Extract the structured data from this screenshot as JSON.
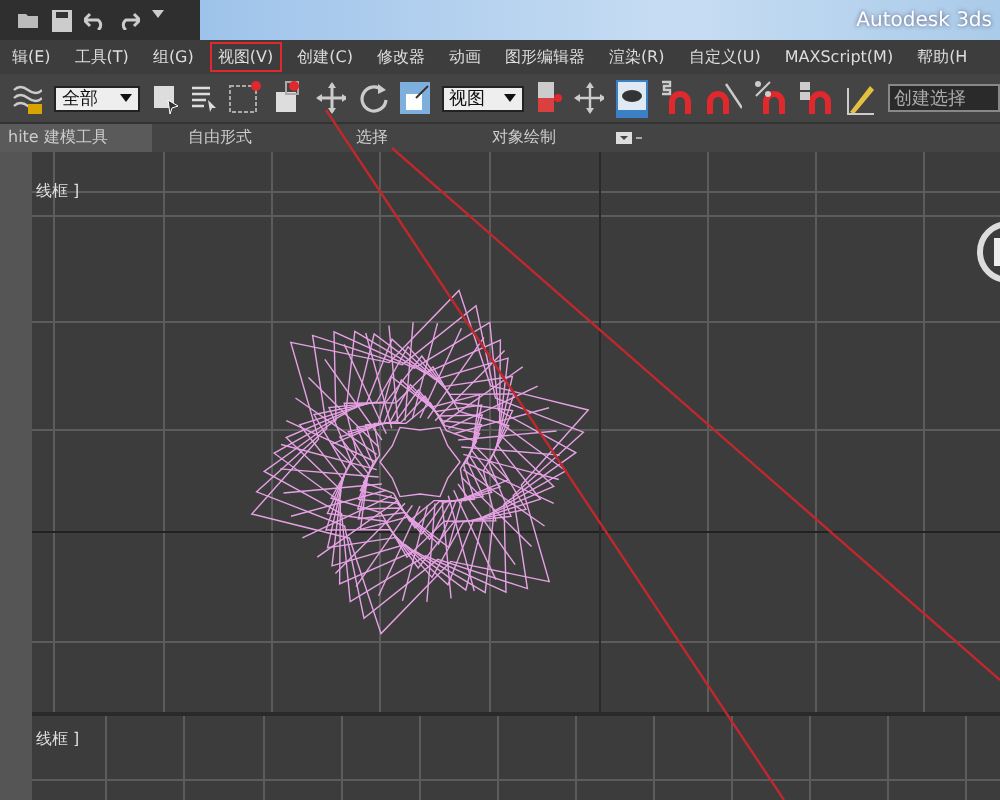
{
  "window": {
    "title": "Autodesk 3ds"
  },
  "menu": [
    {
      "label": "辑(E)",
      "highlighted": false
    },
    {
      "label": "工具(T)",
      "highlighted": false
    },
    {
      "label": "组(G)",
      "highlighted": false
    },
    {
      "label": "视图(V)",
      "highlighted": true
    },
    {
      "label": "创建(C)",
      "highlighted": false
    },
    {
      "label": "修改器",
      "highlighted": false
    },
    {
      "label": "动画",
      "highlighted": false
    },
    {
      "label": "图形编辑器",
      "highlighted": false
    },
    {
      "label": "渲染(R)",
      "highlighted": false
    },
    {
      "label": "自定义(U)",
      "highlighted": false
    },
    {
      "label": "MAXScript(M)",
      "highlighted": false
    },
    {
      "label": "帮助(H",
      "highlighted": false
    }
  ],
  "toolbar": {
    "selection_filter": "全部",
    "reference_coord": "视图",
    "named_selection": "创建选择"
  },
  "ribbon_tabs": [
    {
      "label": "hite 建模工具",
      "selected": true
    },
    {
      "label": "自由形式",
      "selected": false
    },
    {
      "label": "选择",
      "selected": false
    },
    {
      "label": "对象绘制",
      "selected": false
    }
  ],
  "viewports": [
    {
      "label": "线框 ]"
    },
    {
      "label": "线框 ]"
    }
  ]
}
